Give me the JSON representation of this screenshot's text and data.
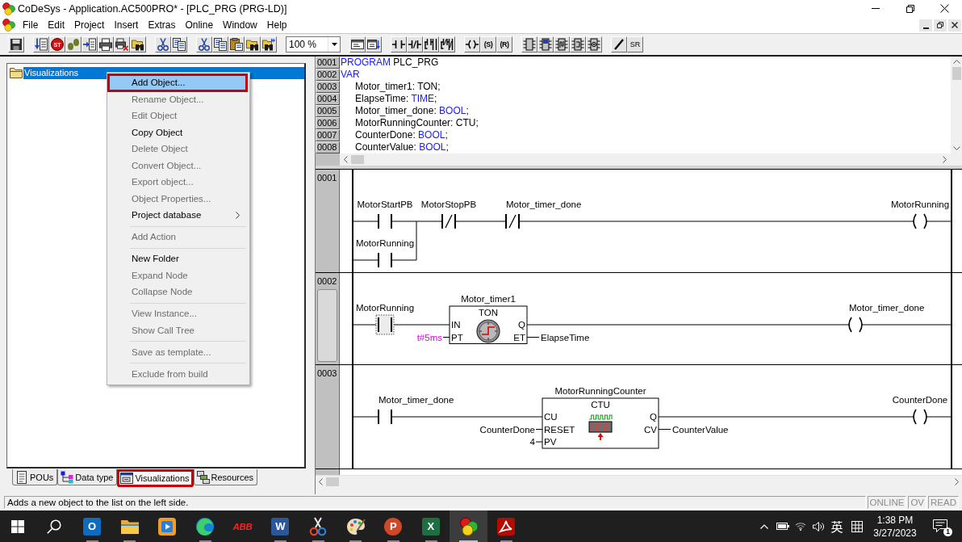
{
  "window": {
    "title": "CoDeSys - Application.AC500PRO* - [PLC_PRG (PRG-LD)]"
  },
  "menu_bar": [
    {
      "label": "File"
    },
    {
      "label": "Edit"
    },
    {
      "label": "Project"
    },
    {
      "label": "Insert"
    },
    {
      "label": "Extras"
    },
    {
      "label": "Online"
    },
    {
      "label": "Window"
    },
    {
      "label": "Help"
    }
  ],
  "toolbar": [
    {
      "kind": "buttons",
      "buttons": [
        {
          "kind": "save"
        }
      ]
    },
    {
      "kind": "buttons",
      "buttons": [
        {
          "kind": "login"
        },
        {
          "kind": "stop",
          "glyph": "ST"
        },
        {
          "kind": "step_over"
        },
        {
          "kind": "step_in"
        },
        {
          "kind": "print"
        },
        {
          "kind": "print_cancel"
        },
        {
          "kind": "find_folder"
        }
      ]
    },
    {
      "kind": "buttons",
      "buttons": [
        {
          "kind": "cut"
        },
        {
          "kind": "copy"
        }
      ]
    },
    {
      "kind": "buttons",
      "buttons": [
        {
          "kind": "cut"
        },
        {
          "kind": "copy"
        },
        {
          "kind": "paste"
        },
        {
          "kind": "find"
        },
        {
          "kind": "find_next"
        }
      ]
    },
    {
      "kind": "combo",
      "value": "100 %"
    },
    {
      "kind": "buttons",
      "buttons": [
        {
          "kind": "network"
        },
        {
          "kind": "network_insert"
        }
      ]
    },
    {
      "kind": "buttons",
      "buttons": [
        {
          "kind": "contact"
        },
        {
          "kind": "negated_contact"
        },
        {
          "kind": "parallel_contact"
        },
        {
          "kind": "parallel_negated_contact"
        }
      ]
    },
    {
      "kind": "buttons",
      "buttons": [
        {
          "kind": "coil"
        },
        {
          "kind": "set_coil",
          "glyph": "(S)"
        },
        {
          "kind": "reset_coil",
          "glyph": "(R)"
        }
      ]
    },
    {
      "kind": "buttons",
      "buttons": [
        {
          "kind": "block"
        },
        {
          "kind": "block_en"
        },
        {
          "kind": "block_jump"
        },
        {
          "kind": "block_return"
        },
        {
          "kind": "block_comment"
        }
      ]
    },
    {
      "kind": "buttons",
      "buttons": [
        {
          "kind": "line"
        },
        {
          "kind": "set_reset",
          "glyph": "$^{S}$$_{R}$"
        }
      ]
    }
  ],
  "object_tree": {
    "items": [
      {
        "label": "Visualizations",
        "selected": true
      }
    ]
  },
  "context_menu": {
    "groups": [
      [
        {
          "label": "Add Object...",
          "enabled": true,
          "selected": true,
          "annotated": true,
          "submenu": false
        },
        {
          "label": "Rename Object...",
          "enabled": false,
          "selected": false,
          "annotated": false,
          "submenu": false
        },
        {
          "label": "Edit Object",
          "enabled": false,
          "selected": false,
          "annotated": false,
          "submenu": false
        },
        {
          "label": "Copy Object",
          "enabled": true,
          "selected": false,
          "annotated": false,
          "submenu": false
        },
        {
          "label": "Delete Object",
          "enabled": false,
          "selected": false,
          "annotated": false,
          "submenu": false
        },
        {
          "label": "Convert Object...",
          "enabled": false,
          "selected": false,
          "annotated": false,
          "submenu": false
        },
        {
          "label": "Export object...",
          "enabled": false,
          "selected": false,
          "annotated": false,
          "submenu": false
        },
        {
          "label": "Object Properties...",
          "enabled": false,
          "selected": false,
          "annotated": false,
          "submenu": false
        },
        {
          "label": "Project database",
          "enabled": true,
          "selected": false,
          "annotated": false,
          "submenu": true
        }
      ],
      [
        {
          "label": "Add Action",
          "enabled": false,
          "selected": false,
          "annotated": false,
          "submenu": false
        }
      ],
      [
        {
          "label": "New Folder",
          "enabled": true,
          "selected": false,
          "annotated": false,
          "submenu": false
        },
        {
          "label": "Expand Node",
          "enabled": false,
          "selected": false,
          "annotated": false,
          "submenu": false
        },
        {
          "label": "Collapse Node",
          "enabled": false,
          "selected": false,
          "annotated": false,
          "submenu": false
        }
      ],
      [
        {
          "label": "View Instance...",
          "enabled": false,
          "selected": false,
          "annotated": false,
          "submenu": false
        },
        {
          "label": "Show Call Tree",
          "enabled": false,
          "selected": false,
          "annotated": false,
          "submenu": false
        }
      ],
      [
        {
          "label": "Save as template...",
          "enabled": false,
          "selected": false,
          "annotated": false,
          "submenu": false
        }
      ],
      [
        {
          "label": "Exclude from build",
          "enabled": false,
          "selected": false,
          "annotated": false,
          "submenu": false
        }
      ]
    ]
  },
  "panel_tabs": [
    {
      "label": "POUs",
      "kind": "pou",
      "selected": false,
      "annotated": false
    },
    {
      "label": "Data type",
      "kind": "datatype",
      "selected": false,
      "annotated": false
    },
    {
      "label": "Visualizations",
      "kind": "visualization",
      "selected": true,
      "annotated": true
    },
    {
      "label": "Resources",
      "kind": "resource",
      "selected": false,
      "annotated": false
    }
  ],
  "declaration": {
    "lines": [
      {
        "number": "0001",
        "tokens": [
          {
            "text": "PROGRAM",
            "kind": "keyword"
          },
          {
            "text": " PLC_PRG",
            "kind": "name"
          }
        ]
      },
      {
        "number": "0002",
        "tokens": [
          {
            "text": "VAR",
            "kind": "keyword"
          }
        ],
        "children": [
          {
            "number": "0003",
            "tokens": [
              {
                "text": "Motor_timer1: TON;",
                "kind": "name"
              }
            ]
          },
          {
            "number": "0004",
            "tokens": [
              {
                "text": "ElapseTime: ",
                "kind": "name"
              },
              {
                "text": "TIME",
                "kind": "keyword"
              },
              {
                "text": ";",
                "kind": "name"
              }
            ]
          },
          {
            "number": "0005",
            "tokens": [
              {
                "text": "Motor_timer_done: ",
                "kind": "name"
              },
              {
                "text": "BOOL",
                "kind": "keyword"
              },
              {
                "text": ";",
                "kind": "name"
              }
            ]
          },
          {
            "number": "0006",
            "tokens": [
              {
                "text": "MotorRunningCounter: CTU;",
                "kind": "name"
              }
            ]
          },
          {
            "number": "0007",
            "tokens": [
              {
                "text": "CounterDone: ",
                "kind": "name"
              },
              {
                "text": "BOOL",
                "kind": "keyword"
              },
              {
                "text": ";",
                "kind": "name"
              }
            ]
          },
          {
            "number": "0008",
            "tokens": [
              {
                "text": "CounterValue: ",
                "kind": "name"
              },
              {
                "text": "BOOL",
                "kind": "keyword"
              },
              {
                "text": ";",
                "kind": "name"
              }
            ]
          }
        ]
      }
    ]
  },
  "ladder": {
    "networks": [
      {
        "number": "0001",
        "selected": false,
        "contacts": [
          {
            "label": "MotorStartPB",
            "negated": false,
            "focused": false,
            "parallel": [
              {
                "label": "MotorRunning",
                "negated": false,
                "focused": false
              }
            ]
          },
          {
            "label": "MotorStopPB",
            "negated": true,
            "focused": false
          },
          {
            "label": "Motor_timer_done",
            "negated": true,
            "focused": false
          }
        ],
        "coil": {
          "label": "MotorRunning"
        }
      },
      {
        "number": "0002",
        "selected": true,
        "contacts": [
          {
            "label": "MotorRunning",
            "negated": false,
            "focused": true
          }
        ],
        "block": {
          "instance": "Motor_timer1",
          "type": "TON",
          "kind": "timer",
          "inputs": [
            {
              "pin": "IN"
            },
            {
              "pin": "PT",
              "value": "t#5ms",
              "highlighted": true
            }
          ],
          "outputs": [
            {
              "pin": "Q"
            },
            {
              "pin": "ET",
              "value": "ElapseTime"
            }
          ]
        },
        "coil": {
          "label": "Motor_timer_done"
        }
      },
      {
        "number": "0003",
        "selected": false,
        "contacts": [
          {
            "label": "Motor_timer_done",
            "negated": false,
            "focused": false
          }
        ],
        "block": {
          "instance": "MotorRunningCounter",
          "type": "CTU",
          "kind": "counter",
          "inputs": [
            {
              "pin": "CU"
            },
            {
              "pin": "RESET",
              "value": "CounterDone",
              "highlighted": false
            },
            {
              "pin": "PV",
              "value": "4",
              "highlighted": false
            }
          ],
          "outputs": [
            {
              "pin": "Q"
            },
            {
              "pin": "CV",
              "value": "CounterValue"
            }
          ]
        },
        "coil": {
          "label": "CounterDone"
        }
      }
    ]
  },
  "status_bar": {
    "message": "Adds a new object to the list on the left side.",
    "indicators": [
      {
        "label": "ONLINE",
        "active": false
      },
      {
        "label": "OV",
        "active": false
      },
      {
        "label": "READ",
        "active": false
      }
    ]
  },
  "taskbar": {
    "apps": [
      {
        "kind": "start",
        "selected": false,
        "running": false
      },
      {
        "kind": "search",
        "selected": false,
        "running": false
      },
      {
        "kind": "outlook",
        "glyph": "O",
        "selected": false,
        "running": true
      },
      {
        "kind": "explorer",
        "selected": false,
        "running": true
      },
      {
        "kind": "media",
        "selected": false,
        "running": false
      },
      {
        "kind": "edge",
        "selected": false,
        "running": true
      },
      {
        "kind": "abb",
        "glyph": "ABB",
        "selected": false,
        "running": false
      },
      {
        "kind": "word",
        "glyph": "W",
        "selected": false,
        "running": true
      },
      {
        "kind": "snip",
        "selected": false,
        "running": true
      },
      {
        "kind": "paint",
        "selected": false,
        "running": true
      },
      {
        "kind": "powerpoint",
        "glyph": "P",
        "selected": false,
        "running": true
      },
      {
        "kind": "excel",
        "glyph": "X",
        "selected": false,
        "running": true
      },
      {
        "kind": "codesys",
        "selected": true,
        "running": true
      },
      {
        "kind": "acrobat",
        "selected": false,
        "running": true
      }
    ],
    "tray": [
      {
        "kind": "chevron"
      },
      {
        "kind": "battery"
      },
      {
        "kind": "wifi"
      },
      {
        "kind": "volume"
      },
      {
        "kind": "ime",
        "glyph": "英"
      },
      {
        "kind": "ime_mode"
      }
    ],
    "clock": {
      "time": "1:38 PM",
      "date": "3/27/2023"
    },
    "notifications": {
      "count": "1"
    }
  }
}
